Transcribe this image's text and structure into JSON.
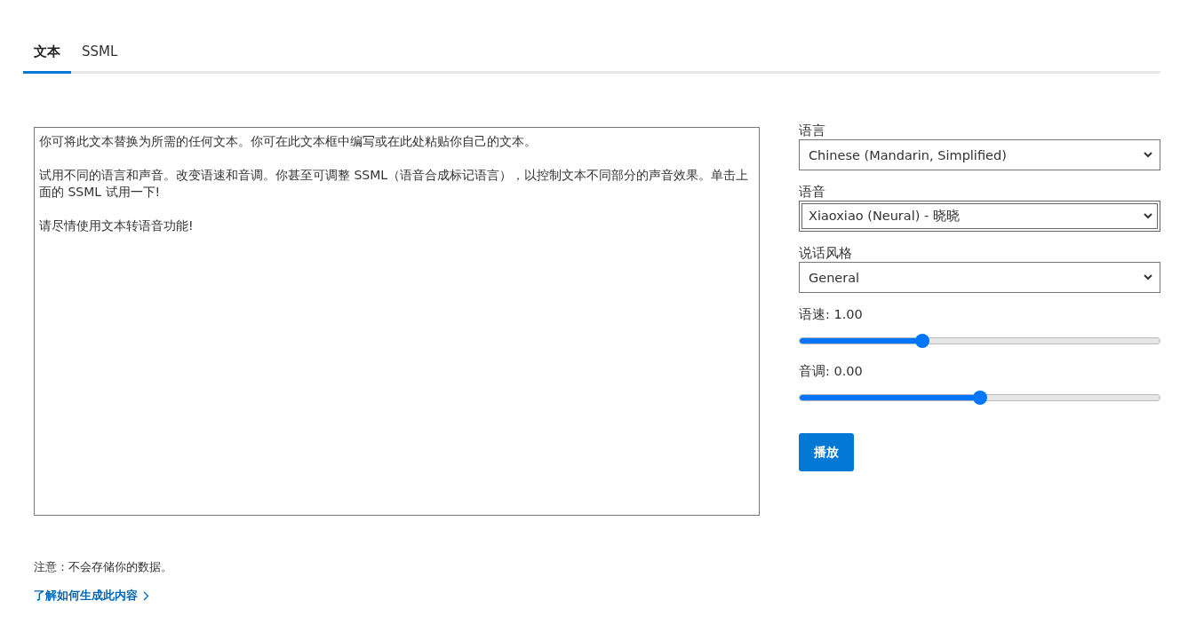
{
  "tabs": [
    {
      "label": "文本",
      "selected": true
    },
    {
      "label": "SSML",
      "selected": false
    }
  ],
  "text_input": {
    "paragraphs": [
      "你可将此文本替换为所需的任何文本。你可在此文本框中编写或在此处粘贴你自己的文本。",
      "试用不同的语言和声音。改变语速和音调。你甚至可调整 SSML（语音合成标记语言），以控制文本不同部分的声音效果。单击上面的 SSML 试用一下!",
      "请尽情使用文本转语音功能!"
    ]
  },
  "controls": [
    {
      "kind": "select",
      "label": "语言",
      "value": "Chinese (Mandarin, Simplified)",
      "focused": false
    },
    {
      "kind": "select",
      "label": "语音",
      "value": "Xiaoxiao (Neural) - 晓晓",
      "focused": true
    },
    {
      "kind": "select",
      "label": "说话风格",
      "value": "General",
      "focused": false
    },
    {
      "kind": "slider",
      "label": "语速: 1.00",
      "level": 0.34
    },
    {
      "kind": "slider",
      "label": "音调: 0.00",
      "level": 0.5
    }
  ],
  "play_button": "播放",
  "note": "注意：不会存储你的数据。",
  "learn_more_link": "了解如何生成此内容"
}
